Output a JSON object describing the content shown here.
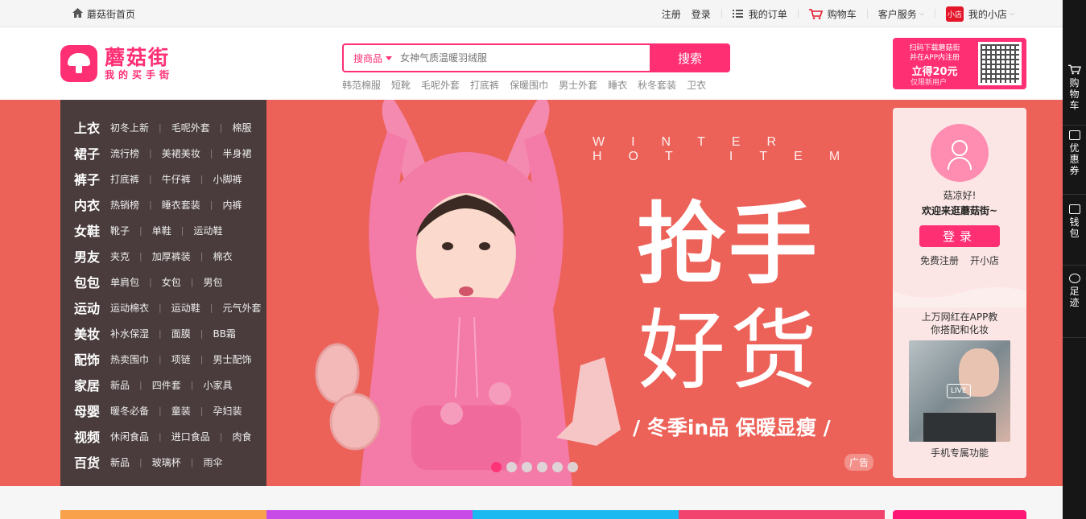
{
  "topbar": {
    "home_label": "蘑菇街首页",
    "register": "注册",
    "login": "登录",
    "orders": "我的订单",
    "cart": "购物车",
    "service": "客户服务",
    "shop_badge": "小店",
    "my_shop": "我的小店"
  },
  "logo": {
    "name": "蘑菇街",
    "slogan": "我的买手街"
  },
  "search": {
    "category": "搜商品",
    "placeholder": "女神气质温暖羽绒服",
    "button": "搜索",
    "hotwords": [
      "韩范棉服",
      "短靴",
      "毛呢外套",
      "打底裤",
      "保暖围巾",
      "男士外套",
      "睡衣",
      "秋冬套装",
      "卫衣"
    ]
  },
  "app_download": {
    "line1": "扫码下载蘑菇街",
    "line2": "并在APP内注册",
    "line3": "立得20元",
    "line4": "仅限新用户"
  },
  "categories": [
    {
      "main": "上衣",
      "subs": [
        "初冬上新",
        "毛呢外套",
        "棉服"
      ]
    },
    {
      "main": "裙子",
      "subs": [
        "流行榜",
        "美裙美妆",
        "半身裙"
      ]
    },
    {
      "main": "裤子",
      "subs": [
        "打底裤",
        "牛仔裤",
        "小脚裤"
      ]
    },
    {
      "main": "内衣",
      "subs": [
        "热销榜",
        "睡衣套装",
        "内裤"
      ]
    },
    {
      "main": "女鞋",
      "subs": [
        "靴子",
        "单鞋",
        "运动鞋"
      ]
    },
    {
      "main": "男友",
      "subs": [
        "夹克",
        "加厚裤装",
        "棉衣"
      ]
    },
    {
      "main": "包包",
      "subs": [
        "单肩包",
        "女包",
        "男包"
      ]
    },
    {
      "main": "运动",
      "subs": [
        "运动棉衣",
        "运动鞋",
        "元气外套"
      ]
    },
    {
      "main": "美妆",
      "subs": [
        "补水保湿",
        "面膜",
        "BB霜"
      ]
    },
    {
      "main": "配饰",
      "subs": [
        "热卖围巾",
        "项链",
        "男士配饰"
      ]
    },
    {
      "main": "家居",
      "subs": [
        "新品",
        "四件套",
        "小家具"
      ]
    },
    {
      "main": "母婴",
      "subs": [
        "暖冬必备",
        "童装",
        "孕妇装"
      ]
    },
    {
      "main": "视频",
      "subs": [
        "休闲食品",
        "进口食品",
        "肉食"
      ]
    },
    {
      "main": "百货",
      "subs": [
        "新品",
        "玻璃杯",
        "雨伞"
      ]
    }
  ],
  "hero": {
    "hot_item": "WINTER HOT ITEM",
    "headline1": "抢手",
    "headline2": "好货",
    "tagline": "/ 冬季in品 保暖显瘦 /",
    "ad_label": "广告",
    "slides": 6,
    "active_slide": 1,
    "bg_color": "#ec6158"
  },
  "user_panel": {
    "hello": "菇凉好!",
    "welcome": "欢迎来逛蘑菇街~",
    "login_button": "登录",
    "register_link": "免费注册",
    "open_shop_link": "开小店",
    "promo_line1": "上万网红在APP教",
    "promo_line2": "你搭配和化妆",
    "live_label": "LIVE",
    "mobile_only": "手机专属功能"
  },
  "sidebar": {
    "cart": "购物车",
    "coupons": "优惠券",
    "wallet": "钱包",
    "footprints": "足迹"
  },
  "colors": {
    "brand": "#ff2f74",
    "nav_bg": "#4a3c3d",
    "sidebar_bg": "#161616",
    "bottom_tabs": [
      "#f8a14a",
      "#c84be8",
      "#1bb9f1",
      "#f2436e"
    ]
  }
}
